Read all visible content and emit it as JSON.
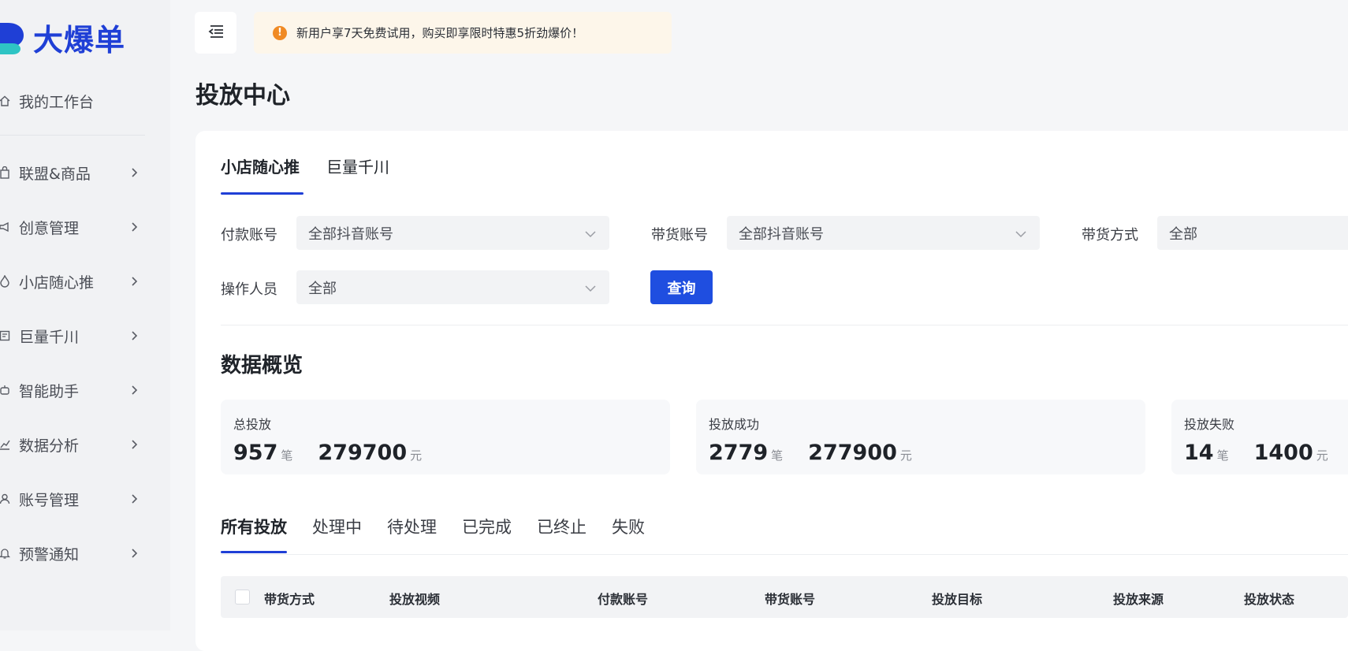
{
  "brand": {
    "name": "大爆单",
    "color": "#1f3fd6"
  },
  "sidebar": {
    "items": [
      {
        "label": "我的工作台",
        "icon": "home-icon",
        "has_arrow": false
      },
      {
        "label": "联盟&商品",
        "icon": "bag-icon",
        "has_arrow": true
      },
      {
        "label": "创意管理",
        "icon": "megaphone-icon",
        "has_arrow": true
      },
      {
        "label": "小店随心推",
        "icon": "flame-icon",
        "has_arrow": true
      },
      {
        "label": "巨量千川",
        "icon": "board-icon",
        "has_arrow": true
      },
      {
        "label": "智能助手",
        "icon": "robot-icon",
        "has_arrow": true
      },
      {
        "label": "数据分析",
        "icon": "chart-icon",
        "has_arrow": true
      },
      {
        "label": "账号管理",
        "icon": "user-icon",
        "has_arrow": true
      },
      {
        "label": "预警通知",
        "icon": "bell-icon",
        "has_arrow": true
      }
    ]
  },
  "topbar": {
    "notice": "新用户享7天免费试用，购买即享限时特惠5折劲爆价！",
    "notice_icon": "alert-icon"
  },
  "page": {
    "title": "投放中心"
  },
  "platform_tabs": [
    {
      "label": "小店随心推",
      "active": true
    },
    {
      "label": "巨量千川",
      "active": false
    }
  ],
  "filters": {
    "pay_account": {
      "label": "付款账号",
      "value": "全部抖音账号"
    },
    "sell_account": {
      "label": "带货账号",
      "value": "全部抖音账号"
    },
    "sell_method": {
      "label": "带货方式",
      "value": "全部"
    },
    "operator": {
      "label": "操作人员",
      "value": "全部"
    },
    "query_label": "查询"
  },
  "overview": {
    "title": "数据概览",
    "stats": [
      {
        "title": "总投放",
        "count": "957",
        "count_unit": "笔",
        "amount": "279700",
        "amount_unit": "元"
      },
      {
        "title": "投放成功",
        "count": "2779",
        "count_unit": "笔",
        "amount": "277900",
        "amount_unit": "元"
      },
      {
        "title": "投放失败",
        "count": "14",
        "count_unit": "笔",
        "amount": "1400",
        "amount_unit": "元"
      }
    ]
  },
  "status_tabs": [
    {
      "label": "所有投放",
      "active": true
    },
    {
      "label": "处理中",
      "active": false
    },
    {
      "label": "待处理",
      "active": false
    },
    {
      "label": "已完成",
      "active": false
    },
    {
      "label": "已终止",
      "active": false
    },
    {
      "label": "失败",
      "active": false
    }
  ],
  "table": {
    "columns": [
      "带货方式",
      "投放视频",
      "付款账号",
      "带货账号",
      "投放目标",
      "投放来源",
      "投放状态"
    ]
  },
  "colors": {
    "accent": "#1f4ee0",
    "notice_bg": "#fdf6ea",
    "notice_icon": "#f08a24"
  }
}
